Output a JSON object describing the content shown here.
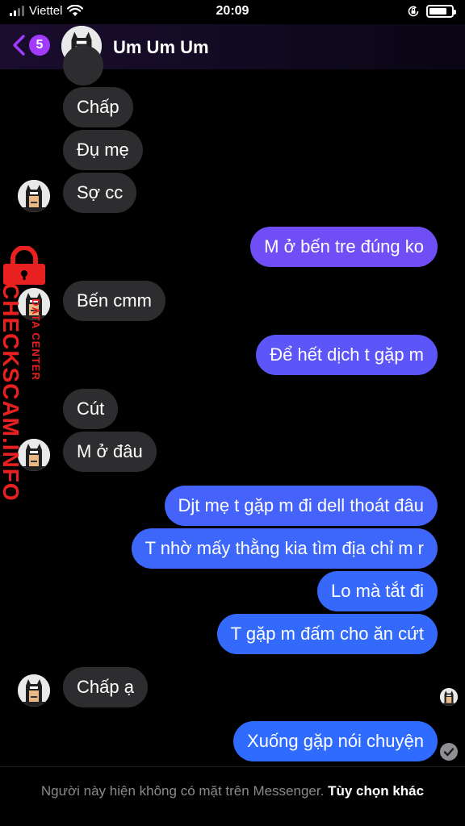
{
  "status_bar": {
    "carrier": "Viettel",
    "time": "20:09",
    "signal_icon": "signal-bars-icon",
    "wifi_icon": "wifi-icon",
    "rotation_lock_icon": "rotation-lock-icon",
    "battery_icon": "battery-icon"
  },
  "header": {
    "back_icon": "chevron-left-icon",
    "unread_count": "5",
    "contact_name": "Um Um Um",
    "accent_color": "#a33bff"
  },
  "messages": [
    {
      "from": "them",
      "text": "Chấp"
    },
    {
      "from": "them",
      "text": "Đụ mẹ"
    },
    {
      "from": "them",
      "text": "Sợ cc"
    },
    {
      "from": "me",
      "text": "M ở bến tre đúng ko"
    },
    {
      "from": "them",
      "text": "Bến cmm"
    },
    {
      "from": "me",
      "text": "Để hết dịch t gặp m"
    },
    {
      "from": "them",
      "text": "Cút"
    },
    {
      "from": "them",
      "text": "M ở đâu"
    },
    {
      "from": "me",
      "text": "Djt mẹ t gặp m đi dell thoát đâu"
    },
    {
      "from": "me",
      "text": "T nhờ mấy thằng kia tìm địa chỉ m r"
    },
    {
      "from": "me",
      "text": "Lo mà tắt đi"
    },
    {
      "from": "me",
      "text": "T gặp m đấm cho ăn cứt"
    },
    {
      "from": "them",
      "text": "Chấp ạ"
    },
    {
      "from": "me",
      "text": "Xuống gặp nói chuyện"
    }
  ],
  "watermark": {
    "brand": "CHECKSCAM.INFO",
    "sub": "DATA CENTER",
    "icon": "padlock-icon"
  },
  "footer": {
    "notice": "Người này hiện không có mặt trên Messenger.",
    "link": "Tùy chọn khác"
  },
  "colors": {
    "incoming_bubble": "#2d2d30",
    "outgoing_gradient_top": "#8a4dff",
    "outgoing_gradient_bottom": "#2f6bff",
    "watermark_red": "#e8201f"
  }
}
